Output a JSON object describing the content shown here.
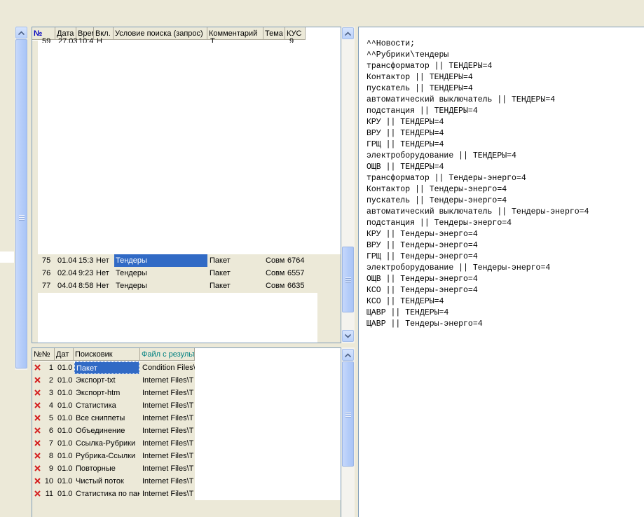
{
  "top_grid": {
    "columns": [
      "№",
      "Дата",
      "Врем",
      "Вкл.",
      "Условие поиска (запрос)",
      "Комментарий",
      "Тема",
      "КУС"
    ],
    "partial_row": [
      "59",
      "27.03",
      "10:4",
      "Н",
      "",
      "Т",
      "",
      "9"
    ],
    "rows": [
      {
        "num": "75",
        "date": "01.04",
        "time": "15:3",
        "on": "Нет",
        "query": "Тендеры",
        "comment": "Пакет",
        "theme": "Совм",
        "kus": "6764",
        "selected": true
      },
      {
        "num": "76",
        "date": "02.04",
        "time": "9:23",
        "on": "Нет",
        "query": "Тендеры",
        "comment": "Пакет",
        "theme": "Совм",
        "kus": "6557",
        "selected": false
      },
      {
        "num": "77",
        "date": "04.04",
        "time": "8:58",
        "on": "Нет",
        "query": "Тендеры",
        "comment": "Пакет",
        "theme": "Совм",
        "kus": "6635",
        "selected": false
      }
    ]
  },
  "bottom_grid": {
    "columns": [
      "№№",
      "Дат",
      "Поисковик",
      "Файл с результ"
    ],
    "rows": [
      {
        "num": "1",
        "date": "01.0",
        "engine": "Пакет",
        "file": "Condition Files\\",
        "selected": true
      },
      {
        "num": "2",
        "date": "01.0",
        "engine": "Экспорт-txt",
        "file": "Internet Files\\Т"
      },
      {
        "num": "3",
        "date": "01.0",
        "engine": "Экспорт-htm",
        "file": "Internet Files\\Т"
      },
      {
        "num": "4",
        "date": "01.0",
        "engine": "Статистика",
        "file": "Internet Files\\Т"
      },
      {
        "num": "5",
        "date": "01.0",
        "engine": "Все сниппеты",
        "file": "Internet Files\\Т"
      },
      {
        "num": "6",
        "date": "01.0",
        "engine": "Объединение",
        "file": "Internet Files\\Т"
      },
      {
        "num": "7",
        "date": "01.0",
        "engine": "Ссылка-Рубрики",
        "file": "Internet Files\\Т"
      },
      {
        "num": "8",
        "date": "01.0",
        "engine": "Рубрика-Ссылки",
        "file": "Internet Files\\Т"
      },
      {
        "num": "9",
        "date": "01.0",
        "engine": "Повторные",
        "file": "Internet Files\\Т"
      },
      {
        "num": "10",
        "date": "01.0",
        "engine": "Чистый поток",
        "file": "Internet Files\\Т"
      },
      {
        "num": "11",
        "date": "01.0",
        "engine": "Статистика по пак",
        "file": "Internet Files\\Т"
      }
    ]
  },
  "text_pane": {
    "lines": [
      "^^Новости;",
      "^^Рубрики\\тендеры",
      "трансформатор || ТЕНДЕРЫ=4",
      "Контактор || ТЕНДЕРЫ=4",
      "пускатель || ТЕНДЕРЫ=4",
      "автоматический выключатель || ТЕНДЕРЫ=4",
      "подстанция || ТЕНДЕРЫ=4",
      "КРУ || ТЕНДЕРЫ=4",
      "ВРУ || ТЕНДЕРЫ=4",
      "ГРЩ || ТЕНДЕРЫ=4",
      "электроборудование || ТЕНДЕРЫ=4",
      "ОЩВ || ТЕНДЕРЫ=4",
      "трансформатор || Тендеры-энерго=4",
      "Контактор || Тендеры-энерго=4",
      "пускатель || Тендеры-энерго=4",
      "автоматический выключатель || Тендеры-энерго=4",
      "подстанция || Тендеры-энерго=4",
      "КРУ || Тендеры-энерго=4",
      "ВРУ || Тендеры-энерго=4",
      "ГРЩ || Тендеры-энерго=4",
      "электроборудование || Тендеры-энерго=4",
      "ОЩВ || Тендеры-энерго=4",
      "КСО || Тендеры-энерго=4",
      "КСО || ТЕНДЕРЫ=4",
      "ЩАВР || ТЕНДЕРЫ=4",
      "ЩАВР || Тендеры-энерго=4"
    ]
  },
  "colors": {
    "background": "#ece9d8",
    "selection": "#316ac5",
    "file_column_header": "#008080",
    "delete_icon": "#d42020"
  },
  "icons": {
    "row_marker": "red-x-icon",
    "scroll_up": "chevron-up-icon",
    "scroll_down": "chevron-down-icon"
  }
}
